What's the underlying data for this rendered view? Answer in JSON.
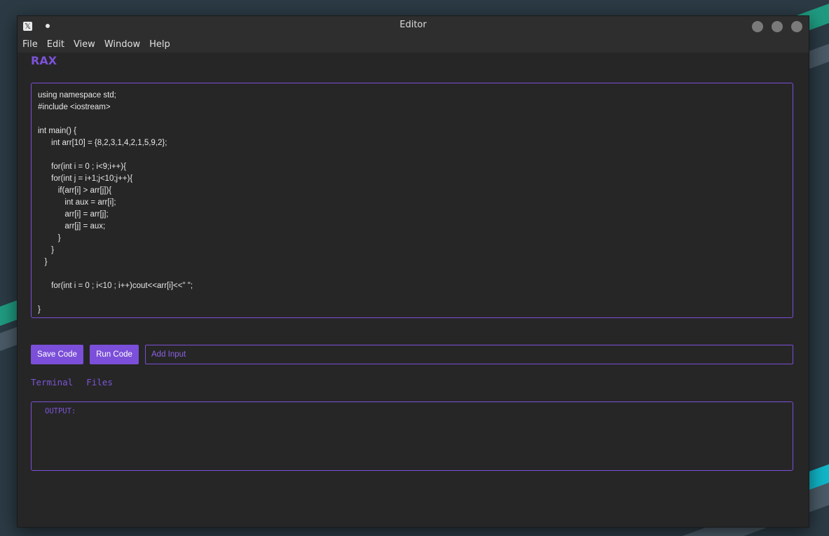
{
  "window": {
    "title": "Editor",
    "app_icon_glyph": "𝕏"
  },
  "menu": {
    "items": [
      "File",
      "Edit",
      "View",
      "Window",
      "Help"
    ]
  },
  "brand": "RAX",
  "code": {
    "lines": [
      "using namespace std;",
      "#include <iostream>",
      "",
      "int main() {",
      "      int arr[10] = {8,2,3,1,4,2,1,5,9,2};",
      "",
      "      for(int i = 0 ; i<9;i++){",
      "      for(int j = i+1;j<10;j++){",
      "         if(arr[i] > arr[j]){",
      "            int aux = arr[i];",
      "            arr[i] = arr[j];",
      "            arr[j] = aux;",
      "         }",
      "      }",
      "   }",
      "",
      "      for(int i = 0 ; i<10 ; i++)cout<<arr[i]<<\" \";",
      "",
      "}"
    ]
  },
  "actions": {
    "save_label": "Save Code",
    "run_label": "Run Code",
    "input_placeholder": "Add Input"
  },
  "tabs": [
    "Terminal",
    "Files"
  ],
  "output": {
    "label": "OUTPUT:"
  },
  "colors": {
    "accent": "#7b4fd9",
    "background": "#262626",
    "titlebar": "#2e2e2e"
  }
}
